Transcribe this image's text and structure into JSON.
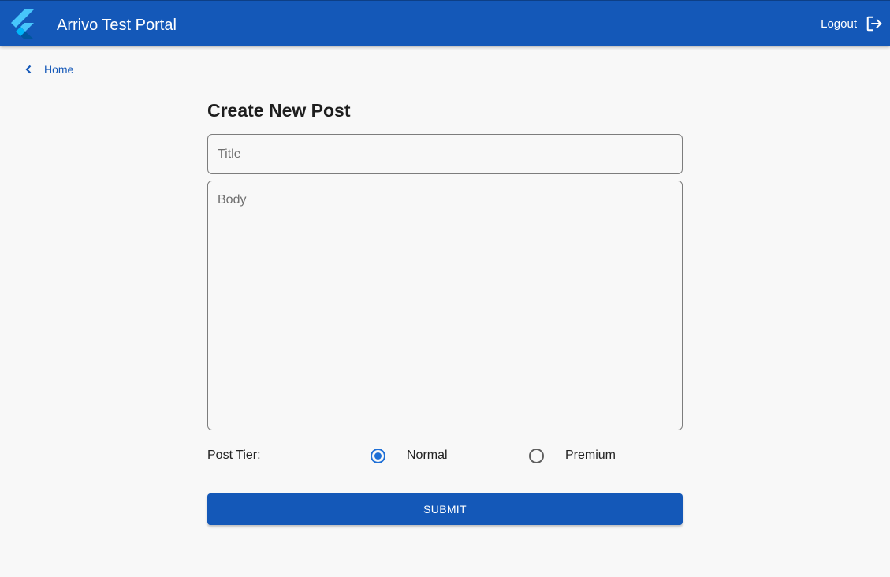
{
  "appbar": {
    "title": "Arrivo Test Portal",
    "logo_icon": "flutter-logo-icon",
    "logout_label": "Logout",
    "logout_icon": "logout-icon",
    "background_color": "#1458b8"
  },
  "navigation": {
    "back_label": "Home",
    "back_icon": "chevron-left-icon"
  },
  "form": {
    "heading": "Create New Post",
    "title_placeholder": "Title",
    "title_value": "",
    "body_placeholder": "Body",
    "body_value": "",
    "tier_label": "Post Tier:",
    "tier_options": [
      {
        "label": "Normal",
        "selected": true
      },
      {
        "label": "Premium",
        "selected": false
      }
    ],
    "submit_label": "SUBMIT"
  }
}
